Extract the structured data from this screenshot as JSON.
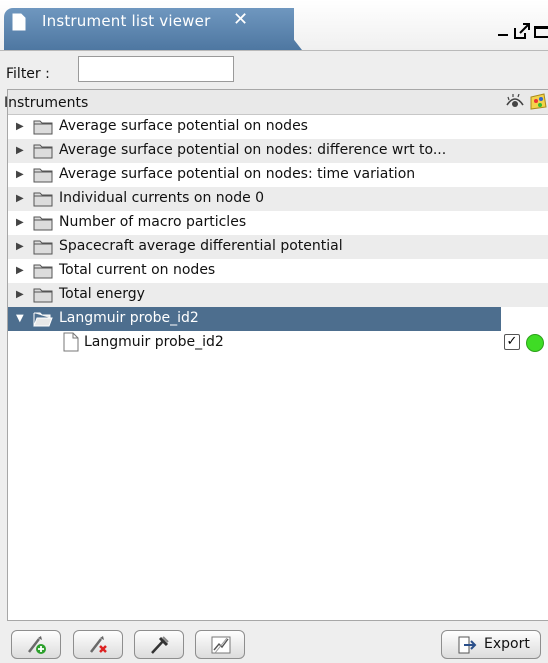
{
  "window": {
    "tab_title": "Instrument list viewer",
    "close_glyph": "✕"
  },
  "filter": {
    "label": "Filter :",
    "value": "",
    "placeholder": ""
  },
  "tree": {
    "header": "Instruments",
    "folders": [
      {
        "label": "Average surface potential on nodes",
        "expanded": false
      },
      {
        "label": "Average surface potential on nodes: difference wrt to...",
        "expanded": false
      },
      {
        "label": "Average surface potential on nodes: time variation",
        "expanded": false
      },
      {
        "label": "Individual currents on node 0",
        "expanded": false
      },
      {
        "label": "Number of macro particles",
        "expanded": false
      },
      {
        "label": "Spacecraft average differential potential",
        "expanded": false
      },
      {
        "label": "Total current on nodes",
        "expanded": false
      },
      {
        "label": "Total energy",
        "expanded": false
      },
      {
        "label": "Langmuir probe_id2",
        "expanded": true,
        "selected": true
      }
    ],
    "child": {
      "label": "Langmuir probe_id2",
      "visible_checked": true,
      "status_color": "#3fdc25"
    }
  },
  "toolbar": {
    "export_label": "Export",
    "icons": [
      "add-instrument-icon",
      "remove-instrument-icon",
      "edit-instrument-icon",
      "plot-instrument-icon",
      "export-icon"
    ]
  },
  "colors": {
    "tab": "#5b84ad",
    "selection": "#4d6e8e",
    "status_ok": "#3fdc25"
  }
}
